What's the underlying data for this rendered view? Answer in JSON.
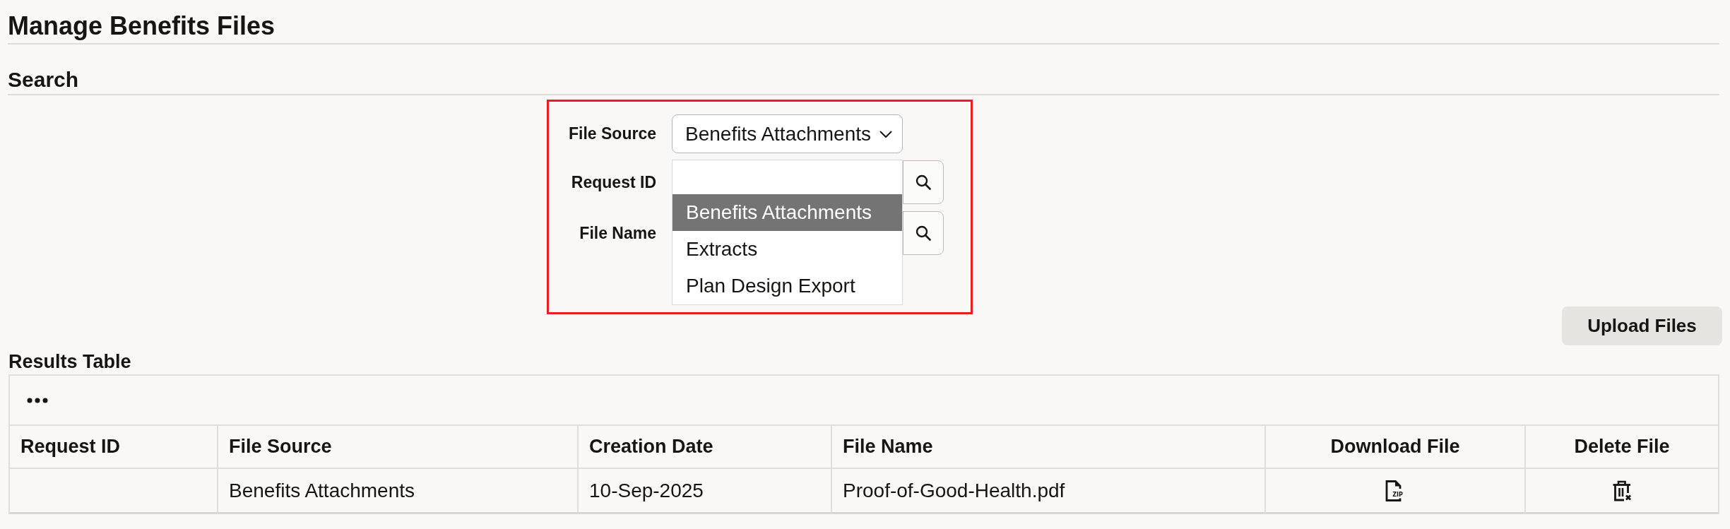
{
  "page": {
    "title": "Manage Benefits Files"
  },
  "search": {
    "heading": "Search",
    "highlighted": true,
    "fields": [
      {
        "kind": "select",
        "label": "File Source",
        "value": "Benefits Attachments",
        "expanded": true,
        "options": [
          {
            "label": "Benefits Attachments",
            "selected": true
          },
          {
            "label": "Extracts",
            "selected": false
          },
          {
            "label": "Plan Design Export",
            "selected": false
          }
        ]
      },
      {
        "kind": "lookup",
        "label": "Request ID"
      },
      {
        "kind": "lookup",
        "label": "File Name"
      }
    ]
  },
  "actions": {
    "buttons": [
      "Upload Files"
    ]
  },
  "results": {
    "heading": "Results Table",
    "columns": [
      {
        "label": "Request ID",
        "kind": "text"
      },
      {
        "label": "File Source",
        "kind": "text"
      },
      {
        "label": "Creation Date",
        "kind": "text"
      },
      {
        "label": "File Name",
        "kind": "text"
      },
      {
        "label": "Download File",
        "kind": "download"
      },
      {
        "label": "Delete File",
        "kind": "delete"
      }
    ],
    "rows": [
      {
        "cells": [
          {},
          {
            "text": "Benefits Attachments"
          },
          {
            "text": "10-Sep-2025"
          },
          {
            "text": "Proof-of-Good-Health.pdf"
          },
          {
            "badge": "ZIP"
          },
          {}
        ]
      }
    ]
  }
}
